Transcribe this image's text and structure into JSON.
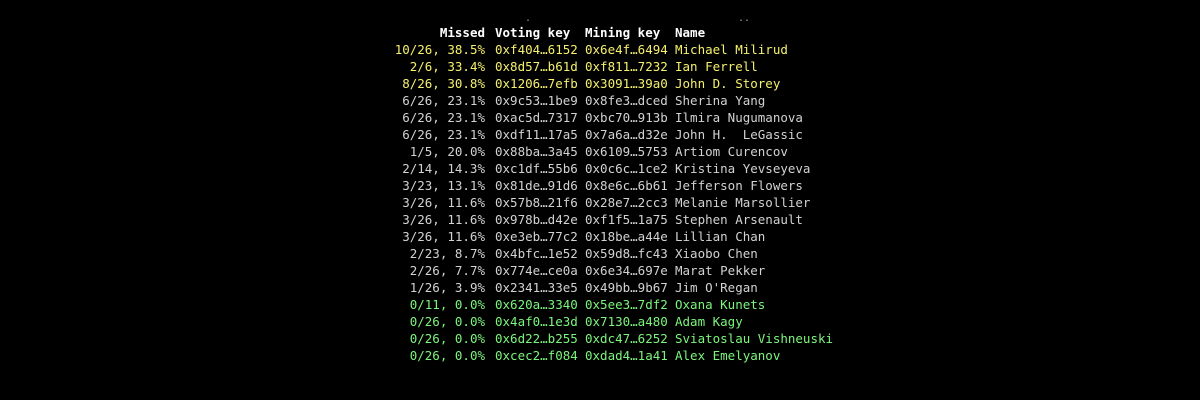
{
  "terminal": {
    "decor_dots": [
      ".",
      ".."
    ],
    "headers": {
      "missed": "Missed",
      "voting_key": "Voting key",
      "mining_key": "Mining key",
      "name": "Name"
    },
    "colors": {
      "background": "#000000",
      "header": "#ffffff",
      "warn": "#f5f06e",
      "normal": "#d2d2d2",
      "ok": "#7cf57c"
    },
    "rows": [
      {
        "missed": "10/26, 38.5%",
        "voting_key": "0xf404…6152",
        "mining_key": "0x6e4f…6494",
        "name": "Michael Milirud",
        "status": "warn"
      },
      {
        "missed": "2/6, 33.4%",
        "voting_key": "0x8d57…b61d",
        "mining_key": "0xf811…7232",
        "name": "Ian Ferrell",
        "status": "warn"
      },
      {
        "missed": "8/26, 30.8%",
        "voting_key": "0x1206…7efb",
        "mining_key": "0x3091…39a0",
        "name": "John D. Storey",
        "status": "warn"
      },
      {
        "missed": "6/26, 23.1%",
        "voting_key": "0x9c53…1be9",
        "mining_key": "0x8fe3…dced",
        "name": "Sherina Yang",
        "status": "normal"
      },
      {
        "missed": "6/26, 23.1%",
        "voting_key": "0xac5d…7317",
        "mining_key": "0xbc70…913b",
        "name": "Ilmira Nugumanova",
        "status": "normal"
      },
      {
        "missed": "6/26, 23.1%",
        "voting_key": "0xdf11…17a5",
        "mining_key": "0x7a6a…d32e",
        "name": "John H.  LeGassic",
        "status": "normal"
      },
      {
        "missed": "1/5, 20.0%",
        "voting_key": "0x88ba…3a45",
        "mining_key": "0x6109…5753",
        "name": "Artiom Curencov",
        "status": "normal"
      },
      {
        "missed": "2/14, 14.3%",
        "voting_key": "0xc1df…55b6",
        "mining_key": "0x0c6c…1ce2",
        "name": "Kristina Yevseyeva",
        "status": "normal"
      },
      {
        "missed": "3/23, 13.1%",
        "voting_key": "0x81de…91d6",
        "mining_key": "0x8e6c…6b61",
        "name": "Jefferson Flowers",
        "status": "normal"
      },
      {
        "missed": "3/26, 11.6%",
        "voting_key": "0x57b8…21f6",
        "mining_key": "0x28e7…2cc3",
        "name": "Melanie Marsollier",
        "status": "normal"
      },
      {
        "missed": "3/26, 11.6%",
        "voting_key": "0x978b…d42e",
        "mining_key": "0xf1f5…1a75",
        "name": "Stephen Arsenault",
        "status": "normal"
      },
      {
        "missed": "3/26, 11.6%",
        "voting_key": "0xe3eb…77c2",
        "mining_key": "0x18be…a44e",
        "name": "Lillian Chan",
        "status": "normal"
      },
      {
        "missed": "2/23, 8.7%",
        "voting_key": "0x4bfc…1e52",
        "mining_key": "0x59d8…fc43",
        "name": "Xiaobo Chen",
        "status": "normal"
      },
      {
        "missed": "2/26, 7.7%",
        "voting_key": "0x774e…ce0a",
        "mining_key": "0x6e34…697e",
        "name": "Marat Pekker",
        "status": "normal"
      },
      {
        "missed": "1/26, 3.9%",
        "voting_key": "0x2341…33e5",
        "mining_key": "0x49bb…9b67",
        "name": "Jim O'Regan",
        "status": "normal"
      },
      {
        "missed": "0/11, 0.0%",
        "voting_key": "0x620a…3340",
        "mining_key": "0x5ee3…7df2",
        "name": "Oxana Kunets",
        "status": "ok"
      },
      {
        "missed": "0/26, 0.0%",
        "voting_key": "0x4af0…1e3d",
        "mining_key": "0x7130…a480",
        "name": "Adam Kagy",
        "status": "ok"
      },
      {
        "missed": "0/26, 0.0%",
        "voting_key": "0x6d22…b255",
        "mining_key": "0xdc47…6252",
        "name": "Sviatoslau Vishneuski",
        "status": "ok"
      },
      {
        "missed": "0/26, 0.0%",
        "voting_key": "0xcec2…f084",
        "mining_key": "0xdad4…1a41",
        "name": "Alex Emelyanov",
        "status": "ok"
      }
    ]
  }
}
